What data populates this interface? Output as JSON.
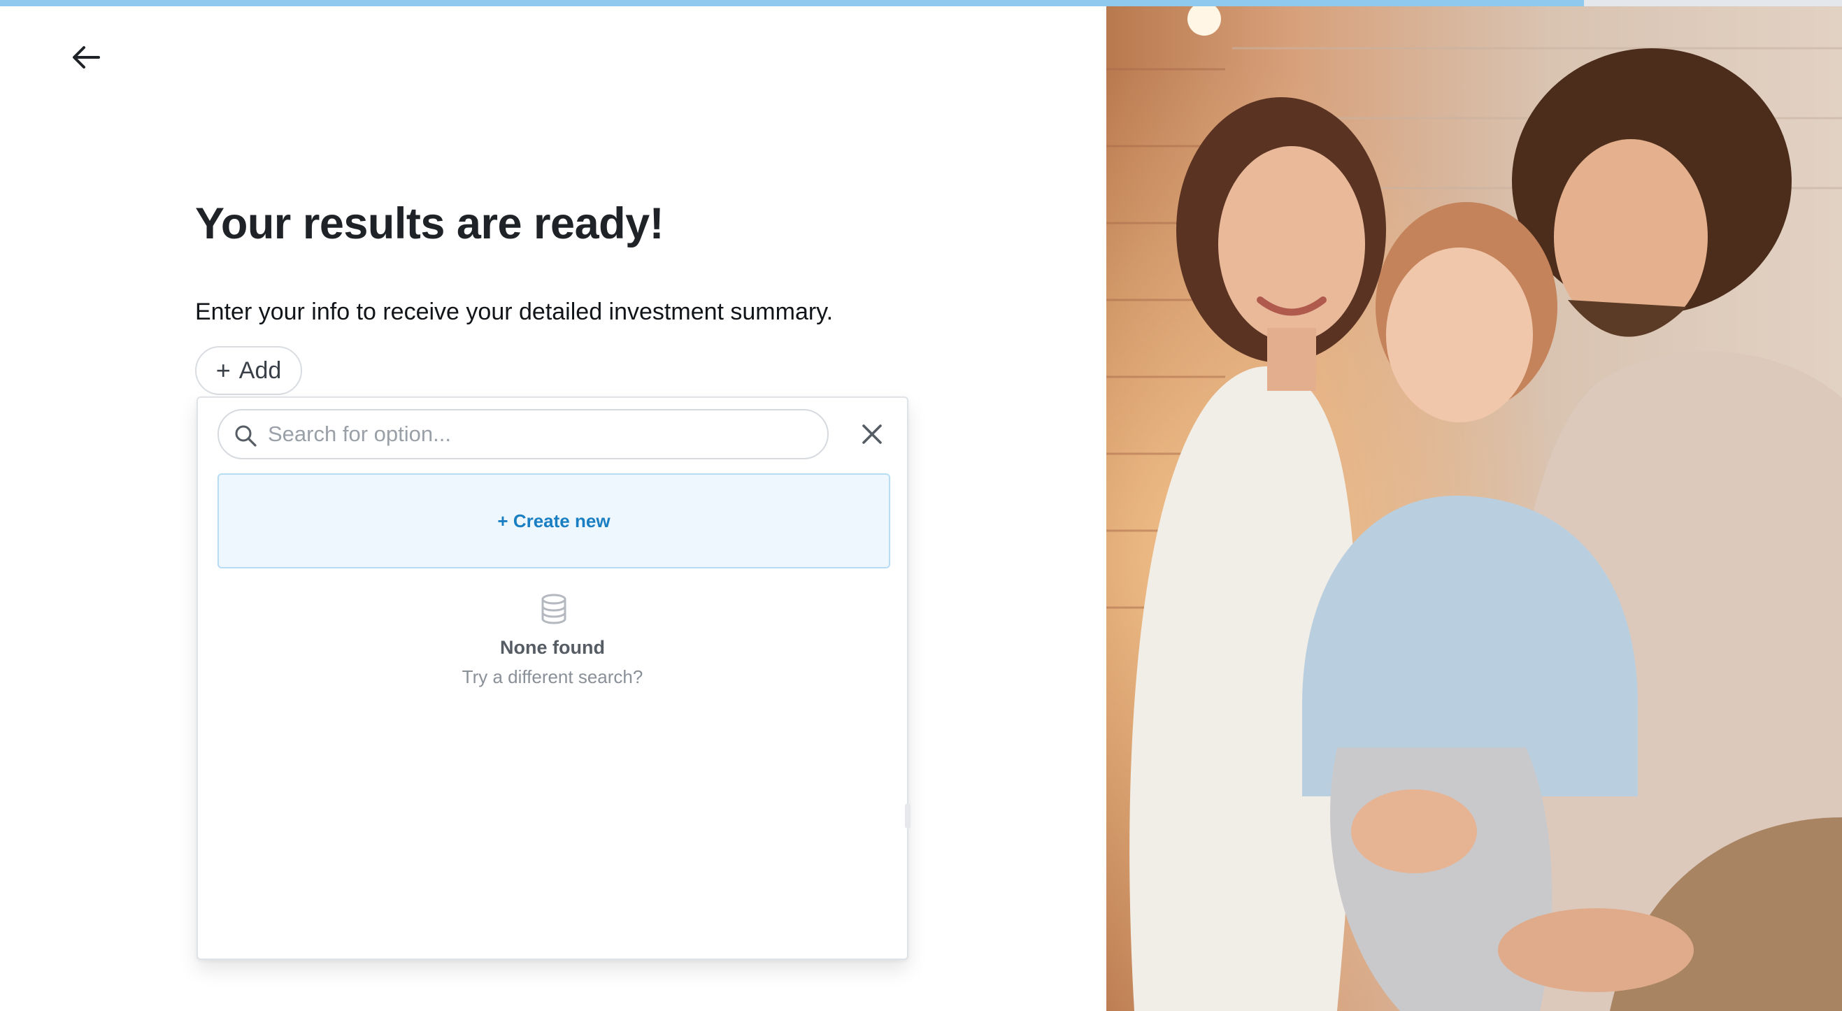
{
  "progress": {
    "fraction": 0.86
  },
  "header": {
    "back_icon": "arrow-left-icon"
  },
  "main": {
    "title": "Your results are ready!",
    "subtitle": "Enter your info to receive your detailed investment summary.",
    "add_button": {
      "icon": "plus-icon",
      "label": "Add"
    }
  },
  "dropdown": {
    "search": {
      "placeholder": "Search for option...",
      "value": "",
      "icon": "search-icon"
    },
    "close_icon": "close-icon",
    "create_new_label": "+ Create new",
    "empty_state": {
      "icon": "database-icon",
      "title": "None found",
      "subtitle": "Try a different search?"
    }
  },
  "colors": {
    "progress_fill": "#8fc9ee",
    "progress_track": "#e4e7eb",
    "create_new_bg": "#eef7fe",
    "create_new_border": "#b7dcf5",
    "create_new_text": "#1a7fc2"
  }
}
